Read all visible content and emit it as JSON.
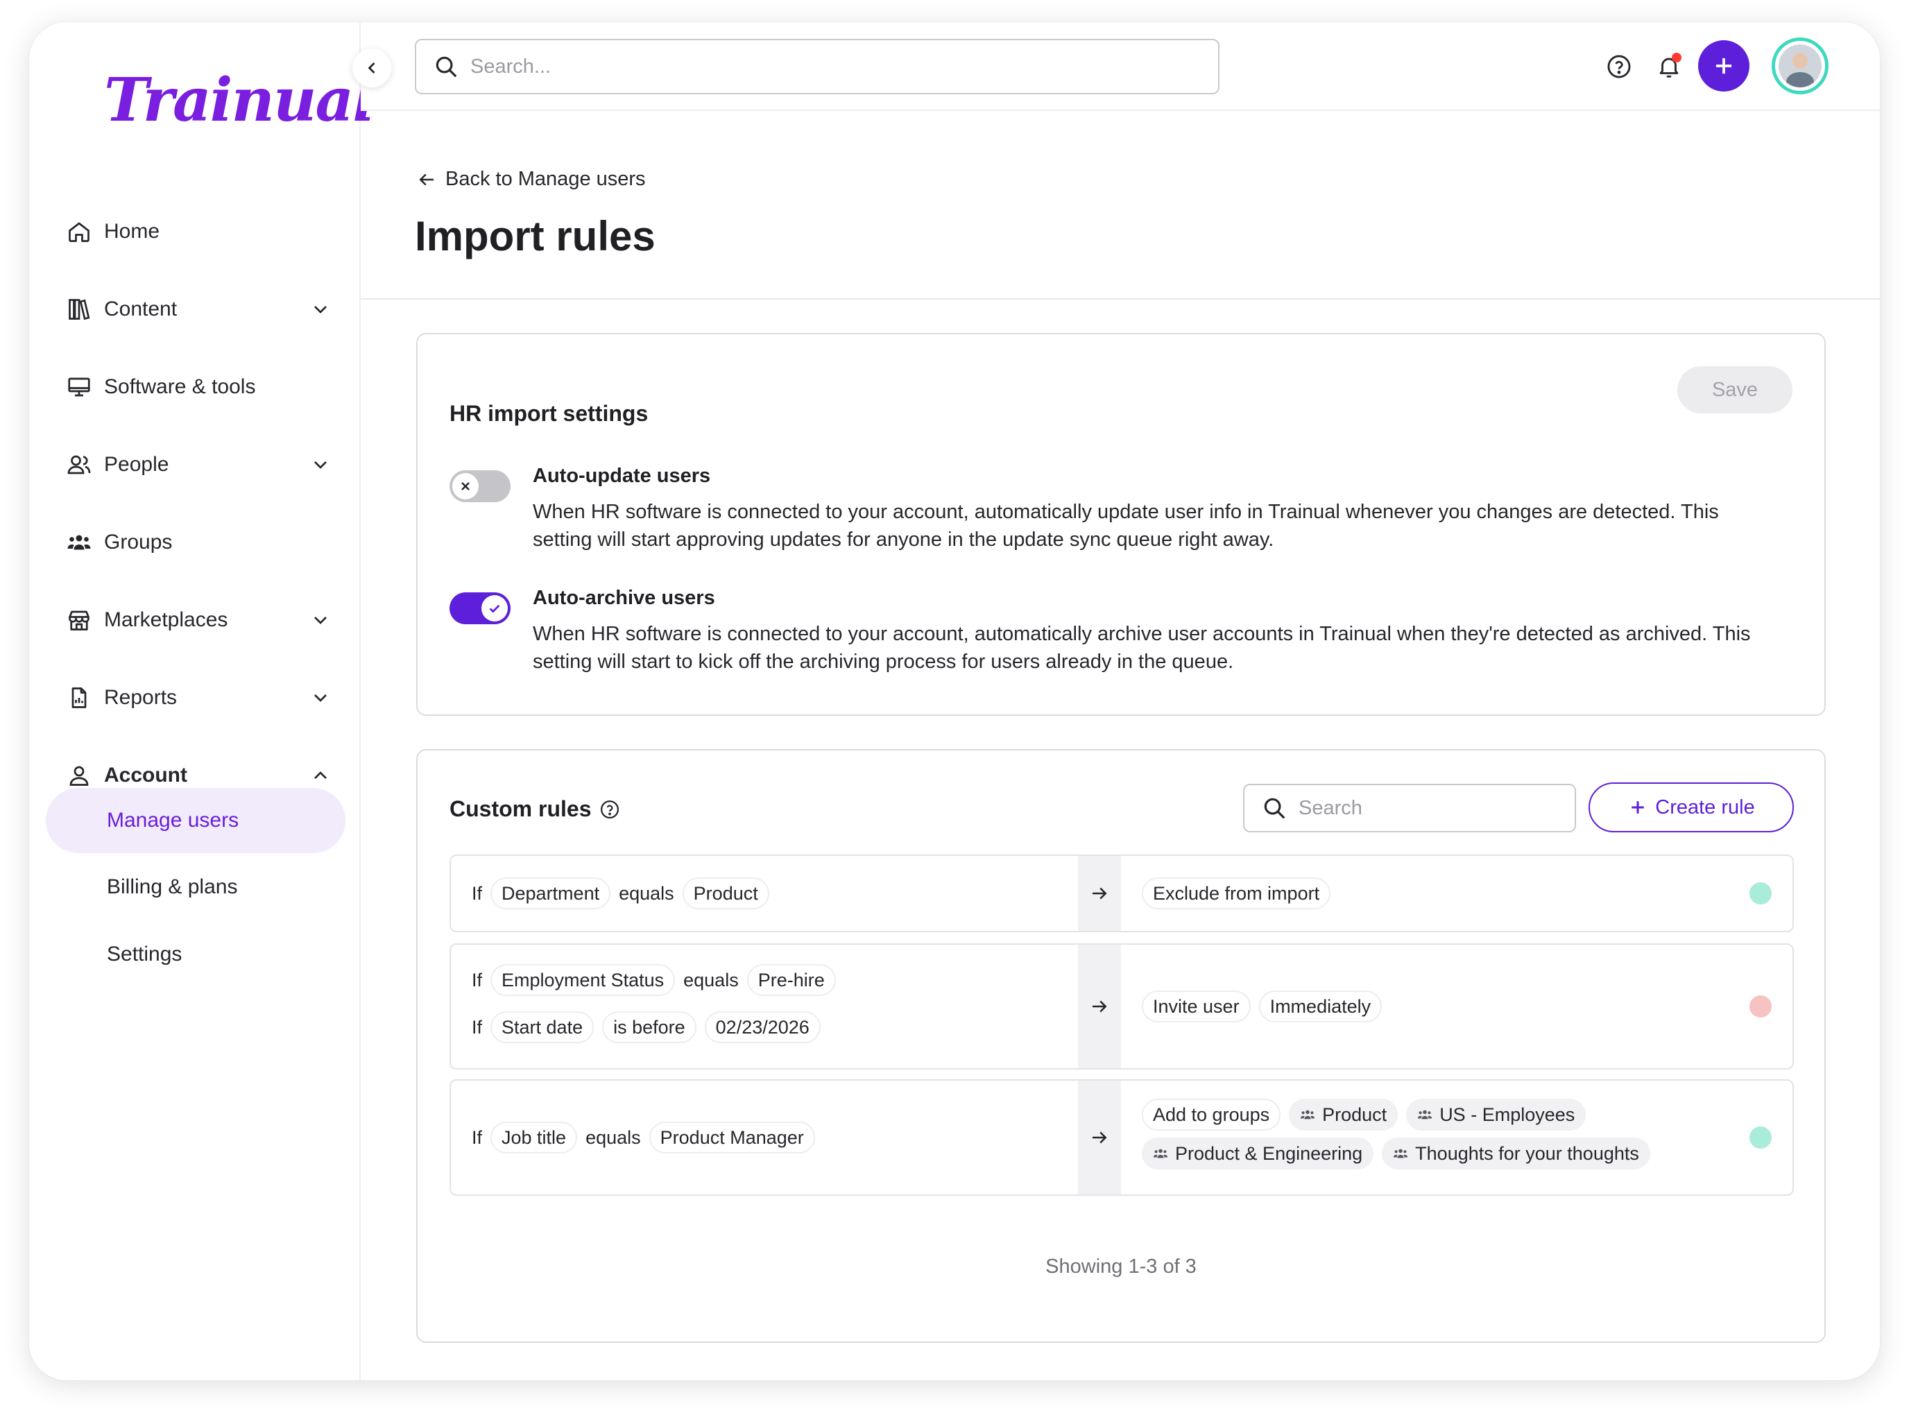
{
  "brand": {
    "logo": "Trainual",
    "accent": "#5d1fd9"
  },
  "topbar": {
    "search_placeholder": "Search..."
  },
  "nav": {
    "home": "Home",
    "content": "Content",
    "software": "Software & tools",
    "people": "People",
    "groups": "Groups",
    "marketplaces": "Marketplaces",
    "reports": "Reports",
    "account": "Account",
    "manage_users": "Manage users",
    "billing": "Billing & plans",
    "settings": "Settings"
  },
  "header": {
    "back": "Back to Manage users",
    "title": "Import rules"
  },
  "hr_settings": {
    "title": "HR import settings",
    "save": "Save",
    "auto_update": {
      "title": "Auto-update users",
      "enabled": false,
      "desc": "When HR software is connected to your account, automatically update user info in Trainual whenever you changes are detected. This setting will start approving updates for anyone in the update sync queue right away."
    },
    "auto_archive": {
      "title": "Auto-archive users",
      "enabled": true,
      "desc": "When HR software is connected to your account, automatically archive user accounts in Trainual when they're detected as archived. This setting will start to kick off the archiving process for users already in the queue."
    }
  },
  "custom_rules": {
    "title": "Custom rules",
    "search_placeholder": "Search",
    "create": "Create rule",
    "rules": [
      {
        "conditions": [
          {
            "if": "If",
            "field": "Department",
            "op": "equals",
            "value": "Product"
          }
        ],
        "actions": [
          "Exclude from import"
        ],
        "status_color": "#a8ecd9"
      },
      {
        "conditions": [
          {
            "if": "If",
            "field": "Employment Status",
            "op": "equals",
            "value": "Pre-hire"
          },
          {
            "if": "If",
            "field": "Start date",
            "op": "is before",
            "value": "02/23/2026"
          }
        ],
        "actions": [
          "Invite user",
          "Immediately"
        ],
        "status_color": "#f6c2c2"
      },
      {
        "conditions": [
          {
            "if": "If",
            "field": "Job title",
            "op": "equals",
            "value": "Product Manager"
          }
        ],
        "action_label": "Add to groups",
        "groups": [
          "Product",
          "US - Employees",
          "Product & Engineering",
          "Thoughts for your thoughts"
        ],
        "status_color": "#a8ecd9"
      }
    ],
    "pager": "Showing  1-3 of 3"
  }
}
